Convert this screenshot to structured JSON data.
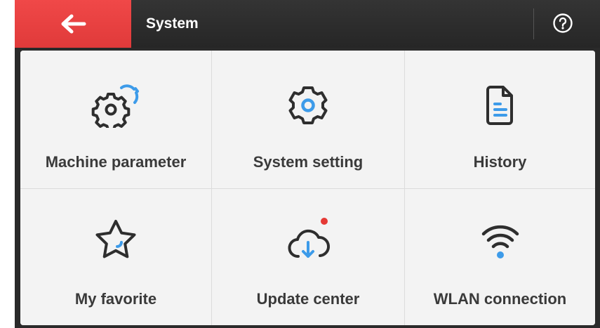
{
  "colors": {
    "accent_red": "#e84242",
    "icon_dark": "#2e2e2e",
    "icon_blue": "#3d9be9",
    "badge_red": "#e53935"
  },
  "header": {
    "back_icon": "arrow-left-icon",
    "title": "System",
    "help_icon": "question-circle-icon"
  },
  "tiles": [
    {
      "label": "Machine parameter",
      "icon": "gears-icon"
    },
    {
      "label": "System setting",
      "icon": "gear-icon"
    },
    {
      "label": "History",
      "icon": "document-icon"
    },
    {
      "label": "My favorite",
      "icon": "star-icon"
    },
    {
      "label": "Update center",
      "icon": "cloud-download-icon",
      "has_notification": true
    },
    {
      "label": "WLAN connection",
      "icon": "wifi-icon"
    }
  ]
}
